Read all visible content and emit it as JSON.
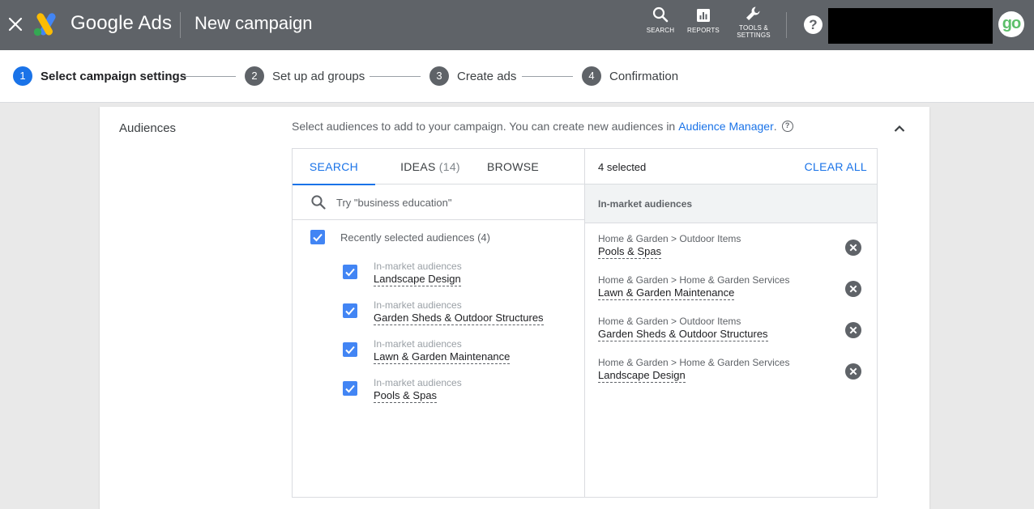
{
  "header": {
    "brand": "Google Ads",
    "title": "New campaign",
    "actions": {
      "search": "SEARCH",
      "reports": "REPORTS",
      "tools_line1": "TOOLS &",
      "tools_line2": "SETTINGS"
    },
    "help": "?",
    "avatar_text": "go"
  },
  "steps": [
    {
      "num": "1",
      "label": "Select campaign settings"
    },
    {
      "num": "2",
      "label": "Set up ad groups"
    },
    {
      "num": "3",
      "label": "Create ads"
    },
    {
      "num": "4",
      "label": "Confirmation"
    }
  ],
  "audiences": {
    "section_label": "Audiences",
    "intro": "Select audiences to add to your campaign. You can create new audiences in",
    "link": "Audience Manager",
    "link_suffix": ".",
    "tabs": {
      "search": "SEARCH",
      "ideas": "IDEAS",
      "ideas_count": "(14)",
      "browse": "BROWSE"
    },
    "search_placeholder": "Try \"business education\"",
    "group_label": "Recently selected audiences (4)",
    "left_items": [
      {
        "category": "In-market audiences",
        "name": "Landscape Design"
      },
      {
        "category": "In-market audiences",
        "name": "Garden Sheds & Outdoor Structures"
      },
      {
        "category": "In-market audiences",
        "name": "Lawn & Garden Maintenance"
      },
      {
        "category": "In-market audiences",
        "name": "Pools & Spas"
      }
    ],
    "selected_count": "4 selected",
    "clear_all": "CLEAR ALL",
    "right_group": "In-market audiences",
    "right_items": [
      {
        "path": "Home & Garden > Outdoor Items",
        "name": "Pools & Spas"
      },
      {
        "path": "Home & Garden > Home & Garden Services",
        "name": "Lawn & Garden Maintenance"
      },
      {
        "path": "Home & Garden > Outdoor Items",
        "name": "Garden Sheds & Outdoor Structures"
      },
      {
        "path": "Home & Garden > Home & Garden Services",
        "name": "Landscape Design"
      }
    ]
  },
  "colors": {
    "topbar": "#5f6368",
    "accent": "#1a73e8",
    "checkbox": "#4285f4"
  }
}
